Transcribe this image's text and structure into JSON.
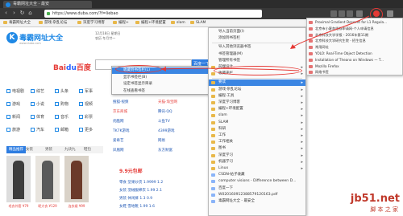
{
  "browser": {
    "tab_title": "毒霸网址大全 - 最安",
    "url": "https://www.duba.com/?f=liebao",
    "bookmarks_bar": [
      "毒霸网址大全",
      "游戏·杂乱论坛",
      "深度学习博客",
      "编程+",
      "编程+环境配置",
      "slam",
      "SLAM"
    ]
  },
  "page": {
    "logo_letter": "K",
    "logo_text": "毒霸网址大全",
    "logo_sub": "www.duba.com",
    "date_line1": "12月18日 星期日",
    "date_line2": "农历 冬月廿一",
    "search_engine": {
      "part1": "Bai",
      "part2": "du",
      "suffix": "百度"
    },
    "search_button": "百度一下",
    "categories": [
      "电视剧",
      "综艺",
      "头条",
      "军事",
      "游戏",
      "小说",
      "购物",
      "视频",
      "新闻",
      "体育",
      "音乐",
      "彩票",
      "旅游",
      "汽车",
      "邮箱",
      "更多"
    ],
    "sites": [
      {
        "text": "百度·hao123",
        "style": "blue"
      },
      {
        "text": "新浪·微博",
        "style": "blue"
      },
      {
        "text": "搜狐·视频",
        "style": "blue"
      },
      {
        "text": "天猫·淘宝网",
        "style": "red"
      },
      {
        "text": "京东商城",
        "style": "red"
      },
      {
        "text": "腾讯·QQ",
        "style": "blue"
      },
      {
        "text": "优酷网",
        "style": "blue"
      },
      {
        "text": "斗鱼TV",
        "style": "blue"
      },
      {
        "text": "TK7K游戏",
        "style": "blue"
      },
      {
        "text": "4399游戏",
        "style": "blue"
      },
      {
        "text": "爱奇艺",
        "style": "blue"
      },
      {
        "text": "网易",
        "style": "blue"
      },
      {
        "text": "凤凰网",
        "style": "blue"
      },
      {
        "text": "东方财富",
        "style": "blue"
      }
    ],
    "category_tabs": [
      "精品推荐",
      "女装",
      "男装",
      "九块九",
      "鞋包"
    ],
    "products": [
      {
        "caption": "毛衣外套 ¥79"
      },
      {
        "caption": "呢大衣 ¥129"
      },
      {
        "caption": "连衣裙 ¥99"
      }
    ],
    "deal_title": "9.9元包邮",
    "deal_rows": [
      "零食   坚果炒货   1.9999   1.2",
      "女装   羽绒服棉衣   1.99   2.1",
      "男装   休闲裤   1.3   0.9",
      "女鞋   雪地靴   1.99   1.6"
    ]
  },
  "context_menu": {
    "items": [
      "收藏到书签栏(L)",
      "显示书签栏(B)",
      "设定书签显示目录",
      "在线查看书签"
    ],
    "highlighted_index": 0
  },
  "bookmarks_menu": {
    "items": [
      {
        "label": "导入当前页面(I)",
        "kind": "action"
      },
      {
        "label": "添加到书签栏",
        "kind": "action"
      },
      {
        "sep": true
      },
      {
        "label": "导入其他浏览器书签",
        "kind": "action"
      },
      {
        "label": "书签管理器(M)",
        "kind": "action"
      },
      {
        "label": "管理所有书签",
        "kind": "action"
      },
      {
        "label": "前端设计",
        "kind": "folder"
      },
      {
        "label": "收藏夹栏",
        "kind": "folder"
      },
      {
        "sep": true
      },
      {
        "label": "要读",
        "kind": "folder",
        "highlight": true
      },
      {
        "label": "游戏·杂乱论坛",
        "kind": "folder"
      },
      {
        "label": "编程·工具",
        "kind": "folder"
      },
      {
        "label": "深度学习博客",
        "kind": "folder"
      },
      {
        "label": "编程+环境配置",
        "kind": "folder"
      },
      {
        "label": "slam",
        "kind": "folder"
      },
      {
        "label": "SLAM",
        "kind": "folder"
      },
      {
        "label": "科研",
        "kind": "folder"
      },
      {
        "label": "工作",
        "kind": "folder"
      },
      {
        "label": "工作相关",
        "kind": "folder"
      },
      {
        "label": "图书",
        "kind": "folder"
      },
      {
        "label": "深度学习",
        "kind": "folder"
      },
      {
        "label": "机器学习",
        "kind": "folder"
      },
      {
        "label": "Linux",
        "kind": "folder"
      },
      {
        "label": "CSDN-帖子收藏",
        "kind": "page"
      },
      {
        "label": "computer visions - Difference between D...",
        "kind": "page"
      },
      {
        "label": "百度一下",
        "kind": "page"
      },
      {
        "label": "W020160912388579120163.pdf",
        "kind": "page"
      },
      {
        "label": "毒霸网址大全 - 最安全",
        "kind": "page"
      }
    ]
  },
  "submenu": {
    "items": [
      "Proximal Gradient Descent for L1 Regula...",
      "北京市小客车指标申请网-个人申请信息",
      "北京科技大学学报 - 2016年第11期",
      "北京科技大学研究生院 - 招生信息",
      "常用网址",
      "YOLO: Real-Time Object Detection",
      "Installation of Theano on Windows — T...",
      "Mozilla Firefox",
      "网络书签"
    ]
  },
  "watermark": {
    "line1": "jb51.net",
    "line2": "脚 本 之 家"
  },
  "colors": {
    "accent": "#3b86e3",
    "annotation": "#e53935",
    "brand": "#1e88e5"
  }
}
